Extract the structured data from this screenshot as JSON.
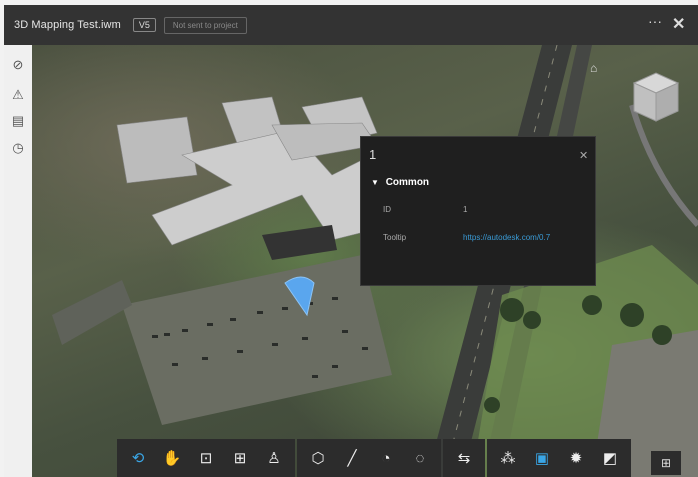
{
  "window": {
    "title": "3D Mapping Test.iwm",
    "version_badge": "V5",
    "status_chip": "Not sent to project",
    "more_label": "···",
    "close_label": "✕"
  },
  "left_rail": {
    "items": [
      {
        "icon": "check-circle-icon",
        "glyph": "⊘"
      },
      {
        "icon": "warning-icon",
        "glyph": "⚠"
      },
      {
        "icon": "clipboard-icon",
        "glyph": "▤"
      },
      {
        "icon": "clock-icon",
        "glyph": "◷"
      }
    ]
  },
  "properties_panel": {
    "title": "1",
    "close_label": "✕",
    "section_title": "Common",
    "rows": [
      {
        "name": "ID",
        "value": "1"
      },
      {
        "name": "Tooltip",
        "value": "https://autodesk.com/0.7"
      }
    ]
  },
  "toolbar": {
    "groups": [
      [
        "orbit-icon",
        "pan-icon",
        "zoom-window-icon",
        "fit-icon",
        "walk-icon"
      ],
      [
        "measure-settings-icon",
        "measure-icon",
        "check-icon",
        "visibility-icon"
      ],
      [
        "section-icon"
      ],
      [
        "model-tree-icon",
        "properties-icon",
        "settings-icon",
        "fullscreen-icon"
      ]
    ],
    "glyphs": {
      "orbit-icon": "⟲",
      "pan-icon": "✋",
      "zoom-window-icon": "⊡",
      "fit-icon": "⊞",
      "walk-icon": "♙",
      "measure-settings-icon": "⬡",
      "measure-icon": "╱",
      "check-icon": "◔",
      "visibility-icon": "◌",
      "section-icon": "⇆",
      "model-tree-icon": "⁂",
      "properties-icon": "▣",
      "settings-icon": "✹",
      "fullscreen-icon": "◩"
    },
    "active": "properties-icon"
  },
  "viewport": {
    "home_glyph": "⌂",
    "grid_glyph": "⊞"
  },
  "colors": {
    "accent": "#3aa6e6",
    "highlight": "#e0242a",
    "link": "#3a9bd6"
  }
}
